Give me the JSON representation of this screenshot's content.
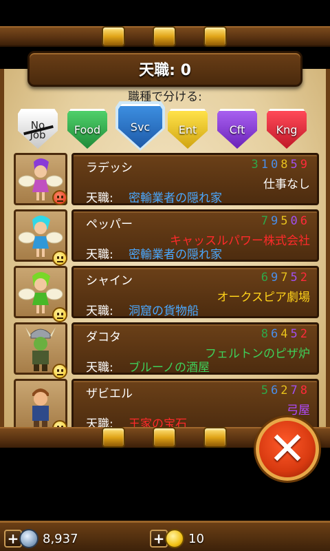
{
  "header": {
    "title": "天職: 0"
  },
  "filter": {
    "label": "職種で分ける:",
    "categories": [
      {
        "id": "nojob",
        "label_top": "No",
        "label_bottom": "Job",
        "color": "#eaeaea",
        "selected": false
      },
      {
        "id": "food",
        "label": "Food",
        "color": "#2ea84a",
        "selected": false
      },
      {
        "id": "svc",
        "label": "Svc",
        "color": "#2e74c8",
        "selected": true
      },
      {
        "id": "ent",
        "label": "Ent",
        "color": "#e8c21c",
        "selected": false
      },
      {
        "id": "cft",
        "label": "Cft",
        "color": "#8a3ad8",
        "selected": false
      },
      {
        "id": "kng",
        "label": "Kng",
        "color": "#e0283a",
        "selected": false
      }
    ]
  },
  "stat_colors": [
    "#2ea84a",
    "#2e74c8",
    "#e8c21c",
    "#8a3ad8",
    "#e0283a"
  ],
  "career_label": "天職:",
  "residents": [
    {
      "name": "ラデッシ",
      "stats": [
        "3",
        "10",
        "8",
        "5",
        "9"
      ],
      "workplace": "仕事なし",
      "workplace_color": "#ffffff",
      "career": "密輸業者の隠れ家",
      "career_color": "#4aa8ff",
      "mood": "unhappy",
      "avatar": "fairy-purple-avatar"
    },
    {
      "name": "ペッパー",
      "stats": [
        "7",
        "9",
        "5",
        "0",
        "6"
      ],
      "workplace": "キャッスルパワー株式会社",
      "workplace_color": "#ff2a2a",
      "career": "密輸業者の隠れ家",
      "career_color": "#4aa8ff",
      "mood": "neutral",
      "avatar": "fairy-cyan-avatar"
    },
    {
      "name": "シャイン",
      "stats": [
        "6",
        "9",
        "7",
        "5",
        "2"
      ],
      "workplace": "オークスピア劇場",
      "workplace_color": "#ffd21a",
      "career": "洞窟の貨物船",
      "career_color": "#4aa8ff",
      "mood": "neutral",
      "avatar": "fairy-green-avatar"
    },
    {
      "name": "ダコタ",
      "stats": [
        "8",
        "6",
        "4",
        "5",
        "2"
      ],
      "workplace": "フェルトンのピザ炉",
      "workplace_color": "#3ed05a",
      "career": "ブルーノの酒屋",
      "career_color": "#3ed05a",
      "mood": "neutral",
      "avatar": "goblin-viking-avatar"
    },
    {
      "name": "ザビエル",
      "stats": [
        "5",
        "6",
        "2",
        "7",
        "8"
      ],
      "workplace": "弓屋",
      "workplace_color": "#b04aff",
      "career": "王家の宝石",
      "career_color": "#ff2a2a",
      "mood": "neutral",
      "avatar": "boy-avatar"
    }
  ],
  "footer": {
    "coins": "8,937",
    "bux": "10"
  }
}
